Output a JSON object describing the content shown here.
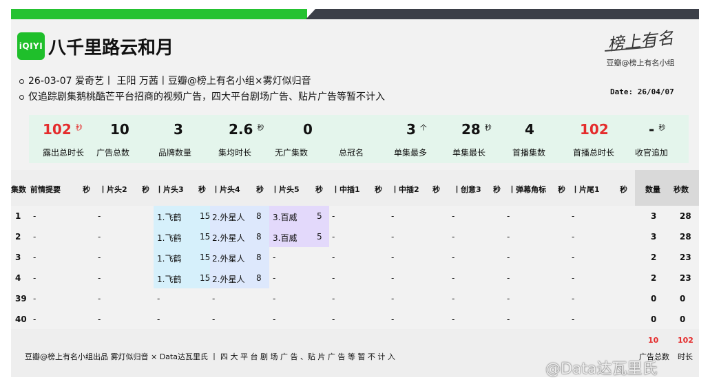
{
  "logo_text": "iQIYI",
  "title": "八千里路云和月",
  "brand": {
    "calligraphy": "榜上有名",
    "sub": "豆瓣@榜上有名小组"
  },
  "info": {
    "line1": "26-03-07  爱奇艺丨 王阳 万茜丨豆瓣@榜上有名小组×雾灯似归音",
    "line2": "仅追踪剧集鹅桃酷芒平台招商的视频广告，四大平台剧场广告、贴片广告等暂不计入"
  },
  "date": "Date: 26/04/07",
  "stats": [
    {
      "value": "102",
      "unit": "秒",
      "label": "露出总时长",
      "red": true
    },
    {
      "value": "10",
      "unit": "",
      "label": "广告总数"
    },
    {
      "value": "3",
      "unit": "",
      "label": "品牌数量"
    },
    {
      "value": "2.6",
      "unit": "秒",
      "label": "集均时长"
    },
    {
      "value": "0",
      "unit": "",
      "label": "无广集数"
    },
    {
      "value": "",
      "unit": "",
      "label": "总冠名"
    },
    {
      "value": "3",
      "unit": "个",
      "label": "单集最多"
    },
    {
      "value": "28",
      "unit": "秒",
      "label": "单集最长"
    },
    {
      "value": "4",
      "unit": "",
      "label": "首播集数"
    },
    {
      "value": "102",
      "unit": "",
      "label": "首播总时长",
      "red": true
    },
    {
      "value": "-",
      "unit": "秒",
      "label": "收官追加"
    }
  ],
  "table": {
    "headers": [
      "集数",
      "前情提要",
      "秒",
      "丨片头2",
      "秒",
      "丨片头3",
      "秒",
      "丨片头4",
      "秒",
      "丨片头5",
      "秒",
      "丨中插1",
      "秒",
      "丨中插2",
      "秒",
      "丨创意3",
      "秒",
      "丨弹幕角标",
      "秒",
      "丨片尾1",
      "秒",
      "数量",
      "秒数"
    ],
    "rows": [
      {
        "ep": "1",
        "c1": "-",
        "c2": "-",
        "c3": "1.飞鹤",
        "s3": "15",
        "c4": "2.外星人",
        "s4": "8",
        "c5": "3.百威",
        "s5": "5",
        "m1": "-",
        "m2": "-",
        "cr": "-",
        "dm": "-",
        "end": "-",
        "count": "3",
        "secs": "28"
      },
      {
        "ep": "2",
        "c1": "-",
        "c2": "-",
        "c3": "1.飞鹤",
        "s3": "15",
        "c4": "2.外星人",
        "s4": "8",
        "c5": "3.百威",
        "s5": "5",
        "m1": "-",
        "m2": "-",
        "cr": "-",
        "dm": "-",
        "end": "-",
        "count": "3",
        "secs": "28"
      },
      {
        "ep": "3",
        "c1": "-",
        "c2": "-",
        "c3": "1.飞鹤",
        "s3": "15",
        "c4": "2.外星人",
        "s4": "8",
        "c5": "-",
        "s5": "",
        "m1": "-",
        "m2": "-",
        "cr": "-",
        "dm": "-",
        "end": "-",
        "count": "2",
        "secs": "23"
      },
      {
        "ep": "4",
        "c1": "-",
        "c2": "-",
        "c3": "1.飞鹤",
        "s3": "15",
        "c4": "2.外星人",
        "s4": "8",
        "c5": "-",
        "s5": "",
        "m1": "-",
        "m2": "-",
        "cr": "-",
        "dm": "-",
        "end": "-",
        "count": "2",
        "secs": "23"
      },
      {
        "ep": "39",
        "c1": "-",
        "c2": "-",
        "c3": "-",
        "s3": "",
        "c4": "-",
        "s4": "",
        "c5": "-",
        "s5": "",
        "m1": "-",
        "m2": "-",
        "cr": "-",
        "dm": "-",
        "end": "-",
        "count": "0",
        "secs": "0"
      },
      {
        "ep": "40",
        "c1": "-",
        "c2": "-",
        "c3": "-",
        "s3": "",
        "c4": "-",
        "s4": "",
        "c5": "-",
        "s5": "",
        "m1": "-",
        "m2": "-",
        "cr": "-",
        "dm": "-",
        "end": "-",
        "count": "0",
        "secs": "0"
      }
    ]
  },
  "footer": {
    "text": "豆瓣@榜上有名小组出品  雾灯似归音 ×  Data达瓦里氏  丨 四 大 平 台 剧 场 广 告 、贴 片 广 告 等 暂 不 计 入",
    "total_count": "10",
    "total_secs": "102",
    "total_count_label": "广告总数",
    "total_secs_label": "时长"
  },
  "watermark": "@Data达瓦里氏",
  "colors": {
    "green": "#25c231",
    "dark": "#3b3f48",
    "red": "#e42c2c"
  }
}
